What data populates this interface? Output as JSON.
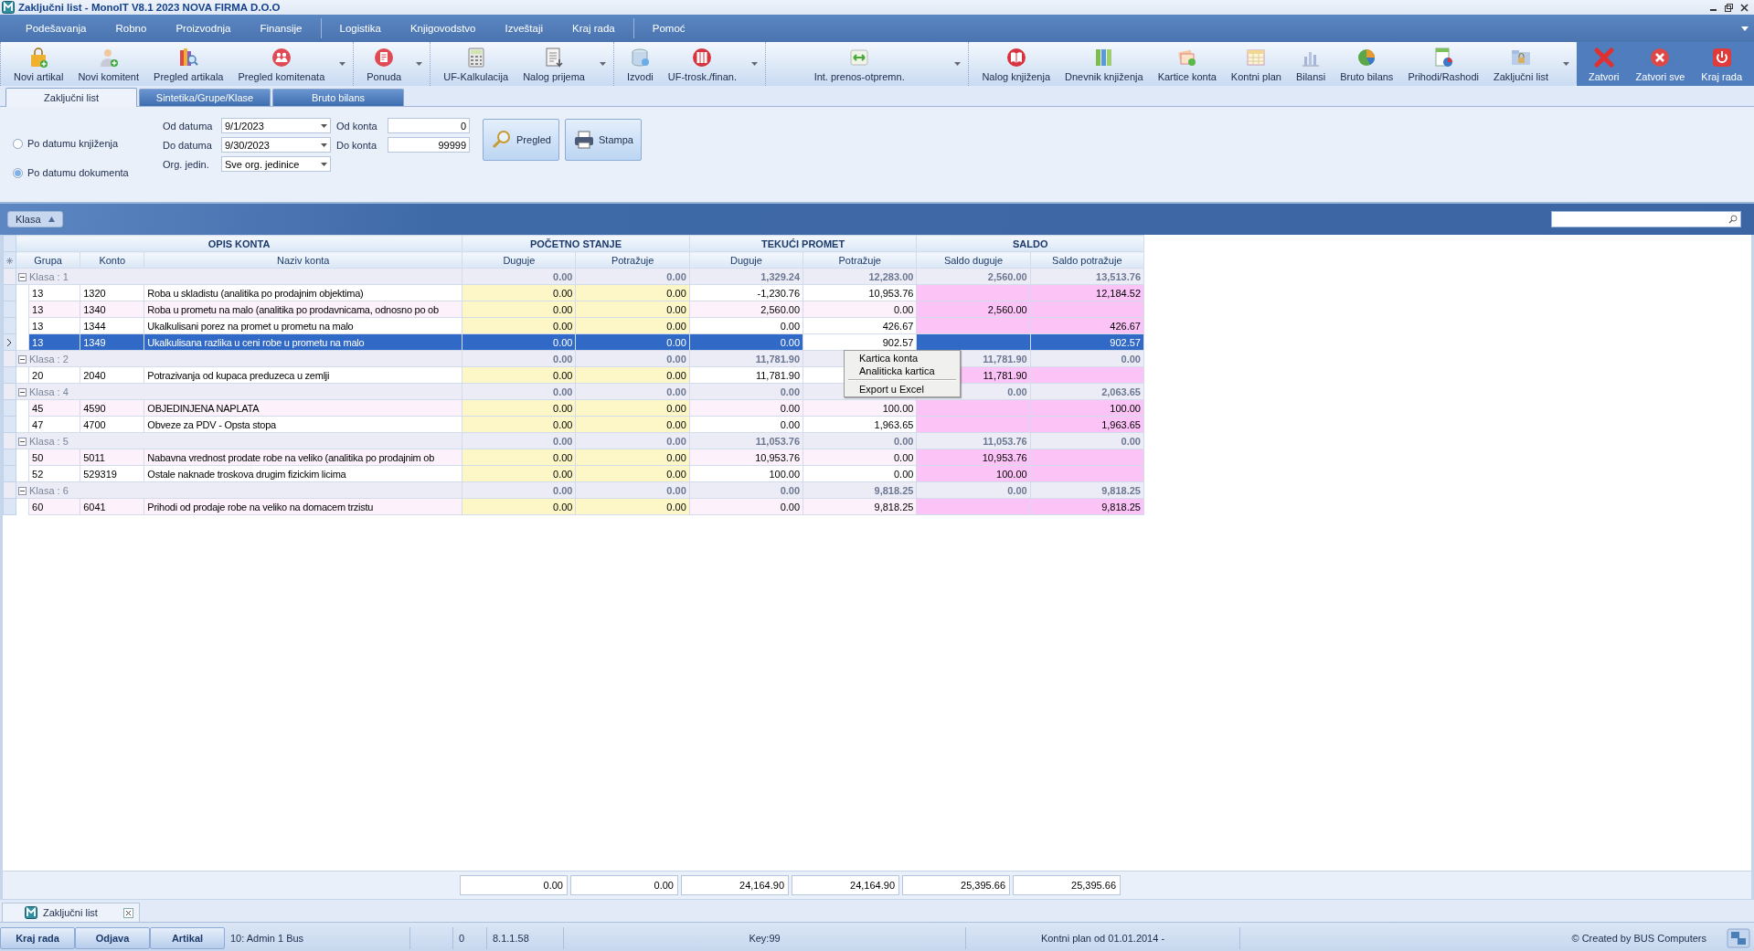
{
  "window": {
    "title": "Zaključni list - MonoIT V8.1 2023 NOVA FIRMA D.O.O"
  },
  "menu": [
    [
      "Podešavanja",
      "Robno",
      "Proizvodnja",
      "Finansije"
    ],
    [
      "Logistika",
      "Knjigovodstvo",
      "Izveštaji",
      "Kraj rada"
    ],
    [
      "Pomoć"
    ]
  ],
  "toolbar": {
    "groups": [
      [
        "Novi artikal",
        "Novi komitent",
        "Pregled artikala",
        "Pregled komitenata"
      ],
      [
        "Ponuda"
      ],
      [
        "UF-Kalkulacija",
        "Nalog prijema"
      ],
      [
        "Izvodi",
        "UF-trosk./finan."
      ],
      [
        "Int. prenos-otpremn."
      ],
      [
        "Nalog knjiženja",
        "Dnevnik knjiženja",
        "Kartice konta",
        "Kontni plan",
        "Bilansi",
        "Bruto bilans",
        "Prihodi/Rashodi",
        "Zaključni list"
      ]
    ],
    "window_actions": [
      "Zatvori",
      "Zatvori sve",
      "Kraj rada"
    ]
  },
  "tabs": [
    {
      "label": "Zaključni list",
      "selected": true
    },
    {
      "label": "Sintetika/Grupe/Klase",
      "selected": false
    },
    {
      "label": "Bruto bilans",
      "selected": false
    }
  ],
  "filter": {
    "radios": [
      {
        "label": "Po datumu knjiženja",
        "selected": false
      },
      {
        "label": "Po datumu dokumenta",
        "selected": true
      }
    ],
    "od_datuma": {
      "label": "Od datuma",
      "value": "9/1/2023"
    },
    "do_datuma": {
      "label": "Do datuma",
      "value": "9/30/2023"
    },
    "org_jedin": {
      "label": "Org. jedin.",
      "value": "Sve org. jedinice"
    },
    "od_konta": {
      "label": "Od konta",
      "value": "0"
    },
    "do_konta": {
      "label": "Do konta",
      "value": "99999"
    },
    "buttons": [
      "Pregled",
      "Stampa"
    ]
  },
  "group_bar": {
    "sort_chip": "Klasa"
  },
  "table": {
    "header_groups": [
      {
        "label": "OPIS KONTA",
        "columns": [
          "Grupa",
          "Konto",
          "Naziv konta"
        ]
      },
      {
        "label": "POČETNO STANJE",
        "columns": [
          "Duguje",
          "Potražuje"
        ]
      },
      {
        "label": "TEKUĆI PROMET",
        "columns": [
          "Duguje",
          "Potražuje"
        ]
      },
      {
        "label": "SALDO",
        "columns": [
          "Saldo duguje",
          "Saldo potražuje"
        ]
      }
    ],
    "groups": [
      {
        "label": "Klasa : 1",
        "expanded": true,
        "totals": {
          "ps_duguje": "0.00",
          "ps_potrazuje": "0.00",
          "tp_duguje": "1,329.24",
          "tp_potrazuje": "12,283.00",
          "saldo_duguje": "2,560.00",
          "saldo_potrazuje": "13,513.76"
        },
        "rows": [
          {
            "grupa": "13",
            "konto": "1320",
            "naziv": "Roba u skladistu (analitika po prodajnim objektima)",
            "values": {
              "ps_duguje": "0.00",
              "ps_potrazuje": "0.00",
              "tp_duguje": "-1,230.76",
              "tp_potrazuje": "10,953.76",
              "saldo_potrazuje": "12,184.52"
            },
            "selected": false
          },
          {
            "grupa": "13",
            "konto": "1340",
            "naziv": "Roba u prometu na malo (analitika po prodavnicama, odnosno po ob",
            "values": {
              "ps_duguje": "0.00",
              "ps_potrazuje": "0.00",
              "tp_duguje": "2,560.00",
              "tp_potrazuje": "0.00",
              "saldo_duguje": "2,560.00"
            },
            "selected": false
          },
          {
            "grupa": "13",
            "konto": "1344",
            "naziv": "Ukalkulisani porez na promet u prometu na malo",
            "values": {
              "ps_duguje": "0.00",
              "ps_potrazuje": "0.00",
              "tp_duguje": "0.00",
              "tp_potrazuje": "426.67",
              "saldo_potrazuje": "426.67"
            },
            "selected": false
          },
          {
            "grupa": "13",
            "konto": "1349",
            "naziv": "Ukalkulisana razlika u ceni robe u prometu na malo",
            "values": {
              "ps_duguje": "0.00",
              "ps_potrazuje": "0.00",
              "tp_duguje": "0.00",
              "tp_potrazuje": "902.57",
              "saldo_potrazuje": "902.57"
            },
            "selected": true
          }
        ]
      },
      {
        "label": "Klasa : 2",
        "expanded": true,
        "totals": {
          "ps_duguje": "0.00",
          "ps_potrazuje": "0.00",
          "tp_duguje": "11,781.90",
          "saldo_duguje": "11,781.90",
          "saldo_potrazuje": "0.00"
        },
        "rows": [
          {
            "grupa": "20",
            "konto": "2040",
            "naziv": "Potrazivanja od kupaca preduzeca u zemlji",
            "values": {
              "ps_duguje": "0.00",
              "ps_potrazuje": "0.00",
              "tp_duguje": "11,781.90",
              "saldo_duguje": "11,781.90"
            },
            "selected": false
          }
        ]
      },
      {
        "label": "Klasa : 4",
        "expanded": true,
        "totals": {
          "ps_duguje": "0.00",
          "ps_potrazuje": "0.00",
          "tp_duguje": "0.00",
          "saldo_duguje": "0.00",
          "saldo_potrazuje": "2,063.65"
        },
        "rows": [
          {
            "grupa": "45",
            "konto": "4590",
            "naziv": "OBJEDINJENA NAPLATA",
            "values": {
              "ps_duguje": "0.00",
              "ps_potrazuje": "0.00",
              "tp_duguje": "0.00",
              "tp_potrazuje": "100.00",
              "saldo_potrazuje": "100.00"
            },
            "selected": false
          },
          {
            "grupa": "47",
            "konto": "4700",
            "naziv": "Obveze za PDV - Opsta stopa",
            "values": {
              "ps_duguje": "0.00",
              "ps_potrazuje": "0.00",
              "tp_duguje": "0.00",
              "tp_potrazuje": "1,963.65",
              "saldo_potrazuje": "1,963.65"
            },
            "selected": false
          }
        ]
      },
      {
        "label": "Klasa : 5",
        "expanded": true,
        "totals": {
          "ps_duguje": "0.00",
          "ps_potrazuje": "0.00",
          "tp_duguje": "11,053.76",
          "tp_potrazuje": "0.00",
          "saldo_duguje": "11,053.76",
          "saldo_potrazuje": "0.00"
        },
        "rows": [
          {
            "grupa": "50",
            "konto": "5011",
            "naziv": "Nabavna vrednost prodate robe na veliko (analitika po prodajnim ob",
            "values": {
              "ps_duguje": "0.00",
              "ps_potrazuje": "0.00",
              "tp_duguje": "10,953.76",
              "tp_potrazuje": "0.00",
              "saldo_duguje": "10,953.76"
            },
            "selected": false
          },
          {
            "grupa": "52",
            "konto": "529319",
            "naziv": "Ostale naknade troskova drugim fizickim licima",
            "values": {
              "ps_duguje": "0.00",
              "ps_potrazuje": "0.00",
              "tp_duguje": "100.00",
              "tp_potrazuje": "0.00",
              "saldo_duguje": "100.00"
            },
            "selected": false
          }
        ]
      },
      {
        "label": "Klasa : 6",
        "expanded": true,
        "totals": {
          "ps_duguje": "0.00",
          "ps_potrazuje": "0.00",
          "tp_duguje": "0.00",
          "tp_potrazuje": "9,818.25",
          "saldo_duguje": "0.00",
          "saldo_potrazuje": "9,818.25"
        },
        "rows": [
          {
            "grupa": "60",
            "konto": "6041",
            "naziv": "Prihodi od prodaje robe na veliko na domacem trzistu",
            "values": {
              "ps_duguje": "0.00",
              "ps_potrazuje": "0.00",
              "tp_duguje": "0.00",
              "tp_potrazuje": "9,818.25",
              "saldo_potrazuje": "9,818.25"
            },
            "selected": false
          }
        ]
      }
    ],
    "totals": [
      "0.00",
      "0.00",
      "24,164.90",
      "24,164.90",
      "25,395.66",
      "25,395.66"
    ]
  },
  "context_menu": [
    [
      "Kartica konta",
      "Analiticka kartica"
    ],
    [
      "Export u Excel"
    ]
  ],
  "document_tabs": [
    {
      "label": "Zaključni list"
    }
  ],
  "status_bar": {
    "buttons": [
      "Kraj rada",
      "Odjava",
      "Artikal"
    ],
    "user": "10: Admin 1 Bus",
    "count": "0",
    "version": "8.1.1.58",
    "key": "Key:99",
    "plan": "Kontni plan od 01.01.2014 -",
    "credit": "© Created by BUS Computers"
  }
}
